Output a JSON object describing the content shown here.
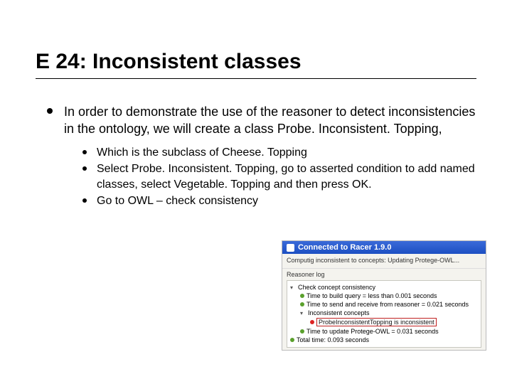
{
  "title": "E 24: Inconsistent classes",
  "main": {
    "text": "In order to demonstrate the use of the reasoner to detect inconsistencies in the ontology, we will create a class Probe. Inconsistent. Topping,",
    "sub": [
      "Which is the subclass of Cheese. Topping",
      "Select Probe. Inconsistent. Topping, go to asserted condition to add named classes, select Vegetable. Topping and then press OK.",
      "Go to OWL – check consistency"
    ]
  },
  "screenshot": {
    "titlebar": "Connected to Racer 1.9.0",
    "status": "Computig inconsistent to concepts: Updating Protege-OWL...",
    "section_label": "Reasoner log",
    "tree": {
      "root": "Check concept consistency",
      "n1": "Time to build query = less than 0.001 seconds",
      "n2": "Time to send and receive from reasoner = 0.021 seconds",
      "n3": "Inconsistent concepts",
      "inconsistent": "ProbeInconsistentTopping is inconsistent",
      "n4": "Time to update Protege-OWL = 0.031 seconds",
      "total": "Total time: 0.093 seconds"
    }
  }
}
